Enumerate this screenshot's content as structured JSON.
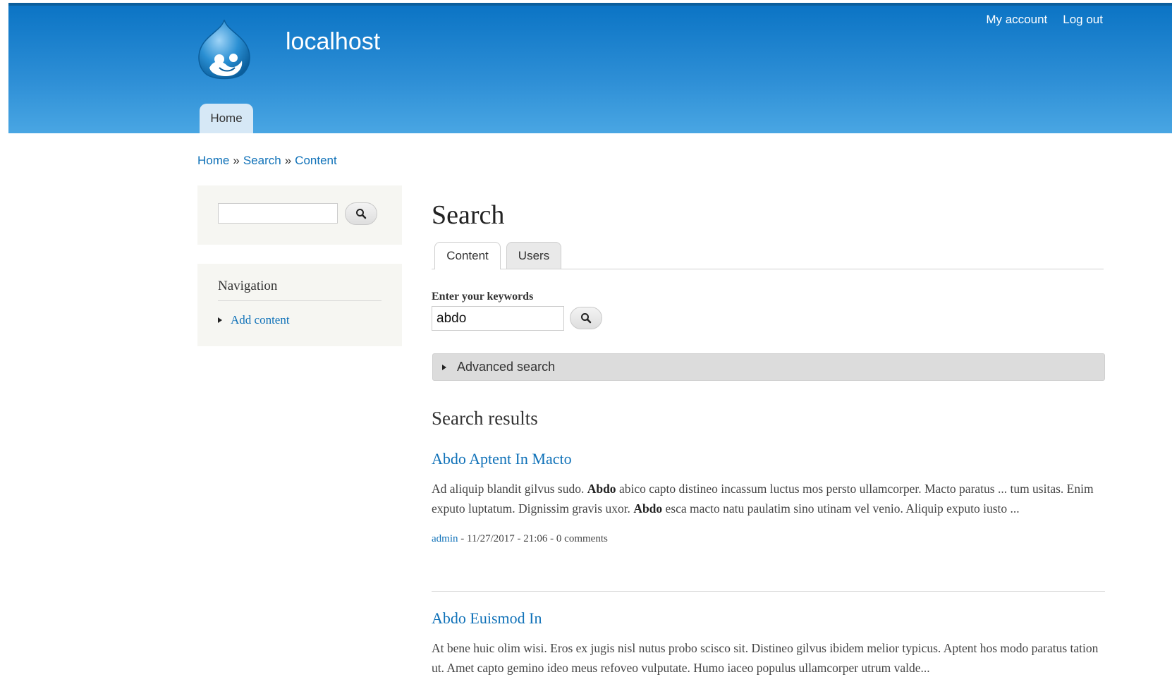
{
  "header": {
    "site_name": "localhost",
    "secondary_menu": [
      "My account",
      "Log out"
    ],
    "main_tab": "Home"
  },
  "breadcrumb": {
    "items": [
      "Home",
      "Search",
      "Content"
    ],
    "separator": "»"
  },
  "sidebar": {
    "search": {
      "value": "",
      "button_icon": "search-icon"
    },
    "navigation": {
      "title": "Navigation",
      "items": [
        "Add content"
      ]
    }
  },
  "main": {
    "title": "Search",
    "tabs": [
      {
        "label": "Content",
        "active": true
      },
      {
        "label": "Users",
        "active": false
      }
    ],
    "keywords_label": "Enter your keywords",
    "keywords_value": "abdo",
    "advanced_label": "Advanced search",
    "results_title": "Search results",
    "results": [
      {
        "title": "Abdo Aptent In Macto",
        "snippet": [
          "Ad aliquip blandit gilvus sudo. ",
          "Abdo",
          " abico capto distineo incassum luctus mos persto ullamcorper. Macto paratus ... tum usitas. Enim exputo luptatum. Dignissim gravis uxor. ",
          "Abdo",
          " esca macto natu paulatim sino utinam vel venio. Aliquip exputo iusto ..."
        ],
        "author": "admin",
        "meta_rest": " - 11/27/2017 - 21:06 - 0 comments"
      },
      {
        "title": "Abdo Euismod In",
        "snippet": [
          "At bene huic olim wisi. Eros ex jugis nisl nutus probo scisco sit. Distineo gilvus ibidem melior typicus. Aptent hos modo paratus tation ut. Amet capto gemino ideo meus refoveo vulputate. Humo iaceo populus ullamcorper utrum valde..."
        ]
      }
    ]
  },
  "colors": {
    "header_top": "#0a73c4",
    "header_bottom": "#49a6e3",
    "link": "#0f71b8",
    "sidebar_bg": "#f6f6f2",
    "advanced_bg": "#dcdcdc"
  }
}
